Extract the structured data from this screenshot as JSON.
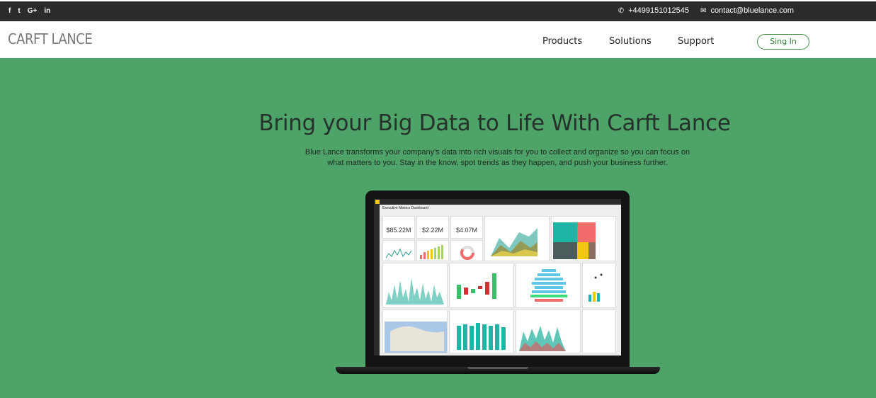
{
  "topbar": {
    "social": [
      "f",
      "t",
      "G+",
      "in"
    ],
    "social_icons": [
      "facebook-icon",
      "twitter-icon",
      "google-plus-icon",
      "linkedin-icon"
    ],
    "phone": "+4499151012545",
    "email": "contact@bluelance.com"
  },
  "nav": {
    "brand": "CARFT LANCE",
    "items": [
      "Products",
      "Solutions",
      "Support"
    ],
    "signin": "Sing In"
  },
  "hero": {
    "headline": "Bring your Big Data to Life With Carft Lance",
    "sub": "Blue Lance transforms your company's data into rich visuals for you to collect and organize so you can focus on what matters to you. Stay in the know, spot trends as they happen, and push your business further."
  },
  "dashboard": {
    "title": "Executive Metrics Dashboard",
    "kpis": [
      "$85.22M",
      "$2.22M",
      "$4.07M"
    ]
  },
  "colors": {
    "hero_bg": "#4ea468",
    "accent": "#3e8e41",
    "topbar_bg": "#2b2b2b"
  }
}
